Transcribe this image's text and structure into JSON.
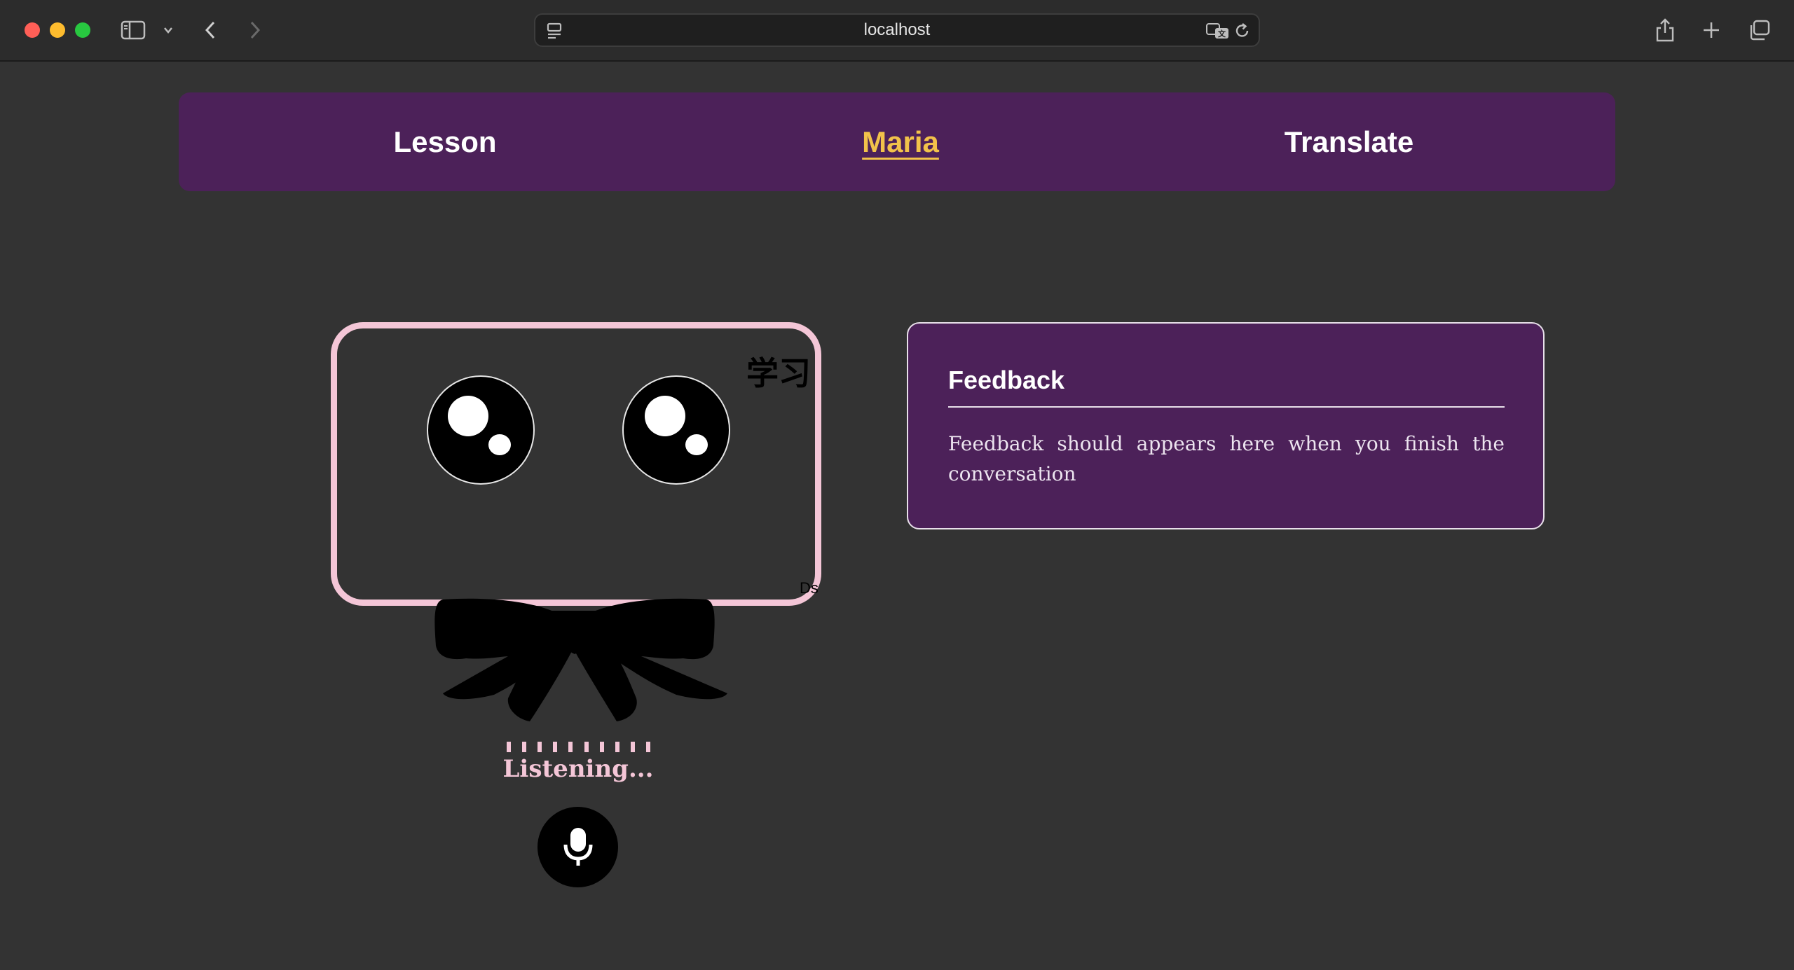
{
  "browser": {
    "address": "localhost",
    "icons": {
      "close": "close-window-icon",
      "minimize": "minimize-window-icon",
      "zoom": "zoom-window-icon",
      "sidebar": "sidebar-icon",
      "back": "back-icon",
      "forward": "forward-icon",
      "page_menu": "page-menu-icon",
      "translate": "translate-icon",
      "reload": "reload-icon",
      "share": "share-icon",
      "new_tab": "new-tab-icon",
      "tab_overview": "tab-overview-icon"
    }
  },
  "nav": {
    "items": [
      {
        "label": "Lesson",
        "active": false
      },
      {
        "label": "Maria",
        "active": true
      },
      {
        "label": "Translate",
        "active": false
      }
    ],
    "active_color": "#f2c24a",
    "background": "#4c2159"
  },
  "character": {
    "badge_text": "学习",
    "signature": "Ds",
    "frame_color": "#f4c6d7",
    "status_text": "Listening...",
    "level_ticks": 10,
    "mic_icon": "microphone-icon"
  },
  "feedback": {
    "title": "Feedback",
    "body": "Feedback should appears here when you finish the conversation"
  }
}
